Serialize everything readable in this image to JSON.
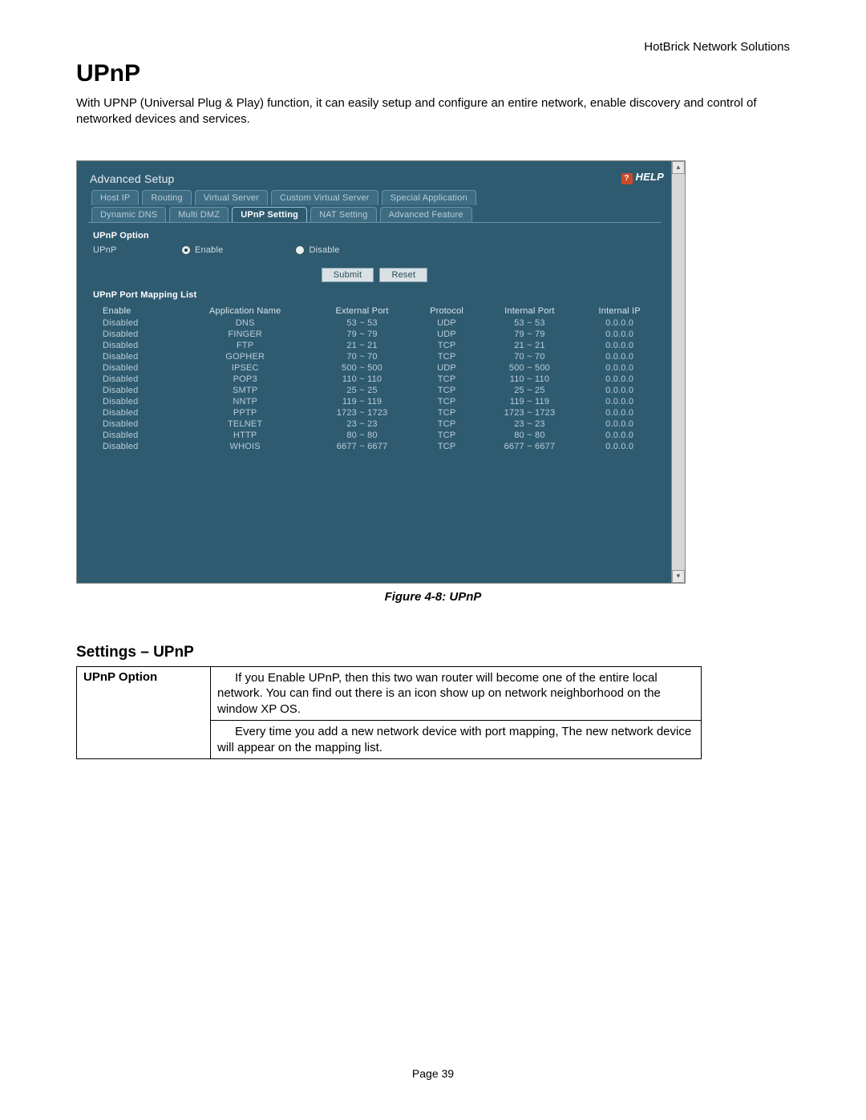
{
  "brand": "HotBrick Network Solutions",
  "title": "UPnP",
  "intro": "With UPNP (Universal Plug & Play) function, it can easily setup and configure an entire network, enable discovery and control of networked devices and services.",
  "figure_caption": "Figure 4-8: UPnP",
  "settings_heading": "Settings – UPnP",
  "spec": {
    "key": "UPnP Option",
    "val1": "If you Enable UPnP, then this two wan router will become one of the entire local network. You can find out there is an icon show up on network neighborhood on the window XP OS.",
    "val2": "Every time you add a new network device with port mapping, The new network device will appear on the mapping list."
  },
  "page_num": "Page 39",
  "ui": {
    "panel_title": "Advanced Setup",
    "help": "HELP",
    "tabs_top": [
      "Host IP",
      "Routing",
      "Virtual Server",
      "Custom Virtual Server",
      "Special Application"
    ],
    "tabs_bottom": [
      "Dynamic DNS",
      "Multi DMZ",
      "UPnP Setting",
      "NAT Setting",
      "Advanced Feature"
    ],
    "active_tab": "UPnP Setting",
    "section1": "UPnP Option",
    "radio_label": "UPnP",
    "radio_enable": "Enable",
    "radio_disable": "Disable",
    "btn_submit": "Submit",
    "btn_reset": "Reset",
    "section2": "UPnP Port Mapping List",
    "cols": [
      "Enable",
      "Application Name",
      "External Port",
      "Protocol",
      "Internal Port",
      "Internal IP"
    ],
    "rows": [
      [
        "Disabled",
        "DNS",
        "53 ~ 53",
        "UDP",
        "53 ~ 53",
        "0.0.0.0"
      ],
      [
        "Disabled",
        "FINGER",
        "79 ~ 79",
        "UDP",
        "79 ~ 79",
        "0.0.0.0"
      ],
      [
        "Disabled",
        "FTP",
        "21 ~ 21",
        "TCP",
        "21 ~ 21",
        "0.0.0.0"
      ],
      [
        "Disabled",
        "GOPHER",
        "70 ~ 70",
        "TCP",
        "70 ~ 70",
        "0.0.0.0"
      ],
      [
        "Disabled",
        "IPSEC",
        "500 ~ 500",
        "UDP",
        "500 ~ 500",
        "0.0.0.0"
      ],
      [
        "Disabled",
        "POP3",
        "110 ~ 110",
        "TCP",
        "110 ~ 110",
        "0.0.0.0"
      ],
      [
        "Disabled",
        "SMTP",
        "25 ~ 25",
        "TCP",
        "25 ~ 25",
        "0.0.0.0"
      ],
      [
        "Disabled",
        "NNTP",
        "119 ~ 119",
        "TCP",
        "119 ~ 119",
        "0.0.0.0"
      ],
      [
        "Disabled",
        "PPTP",
        "1723 ~ 1723",
        "TCP",
        "1723 ~ 1723",
        "0.0.0.0"
      ],
      [
        "Disabled",
        "TELNET",
        "23 ~ 23",
        "TCP",
        "23 ~ 23",
        "0.0.0.0"
      ],
      [
        "Disabled",
        "HTTP",
        "80 ~ 80",
        "TCP",
        "80 ~ 80",
        "0.0.0.0"
      ],
      [
        "Disabled",
        "WHOIS",
        "6677 ~ 6677",
        "TCP",
        "6677 ~ 6677",
        "0.0.0.0"
      ]
    ]
  }
}
